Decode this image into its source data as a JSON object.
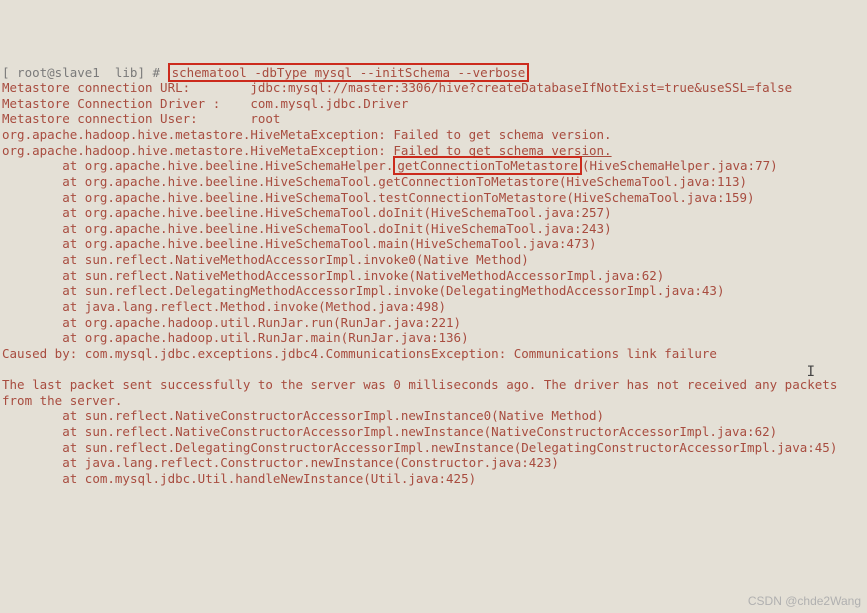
{
  "prompt": "[ root@slave1  lib] # ",
  "cmd": "schematool -dbType mysql --initSchema --verbose",
  "l1": "Metastore connection URL:\t jdbc:mysql://master:3306/hive?createDatabaseIfNotExist=true&useSSL=false",
  "l2": "Metastore Connection Driver :\t com.mysql.jdbc.Driver",
  "l3": "Metastore connection User:\t root",
  "l4": "org.apache.hadoop.hive.metastore.HiveMetaException: Failed to get schema version.",
  "l5": "org.apache.hadoop.hive.metastore.HiveMetaException: ",
  "l5u": "Failed to get schema version.",
  "l6a": "        at org.apache.hive.beeline.HiveSchemaHelper.",
  "l6h": "getConnectionToMetastore",
  "l6b": "(HiveSchemaHelper.java:77)",
  "l7": "        at org.apache.hive.beeline.HiveSchemaTool.getConnectionToMetastore(HiveSchemaTool.java:113)",
  "l8": "        at org.apache.hive.beeline.HiveSchemaTool.testConnectionToMetastore(HiveSchemaTool.java:159)",
  "l9": "        at org.apache.hive.beeline.HiveSchemaTool.doInit(HiveSchemaTool.java:257)",
  "l10": "        at org.apache.hive.beeline.HiveSchemaTool.doInit(HiveSchemaTool.java:243)",
  "l11": "        at org.apache.hive.beeline.HiveSchemaTool.main(HiveSchemaTool.java:473)",
  "l12": "        at sun.reflect.NativeMethodAccessorImpl.invoke0(Native Method)",
  "l13": "        at sun.reflect.NativeMethodAccessorImpl.invoke(NativeMethodAccessorImpl.java:62)",
  "l14": "        at sun.reflect.DelegatingMethodAccessorImpl.invoke(DelegatingMethodAccessorImpl.java:43)",
  "l15": "        at java.lang.reflect.Method.invoke(Method.java:498)",
  "l16": "        at org.apache.hadoop.util.RunJar.run(RunJar.java:221)",
  "l17": "        at org.apache.hadoop.util.RunJar.main(RunJar.java:136)",
  "l18": "Caused by: com.mysql.jdbc.exceptions.jdbc4.CommunicationsException: Communications link failure",
  "blank": "",
  "l19": "The last packet sent successfully to the server was 0 milliseconds ago. The driver has not received any packets from the server.",
  "l20": "        at sun.reflect.NativeConstructorAccessorImpl.newInstance0(Native Method)",
  "l21": "        at sun.reflect.NativeConstructorAccessorImpl.newInstance(NativeConstructorAccessorImpl.java:62)",
  "l22": "        at sun.reflect.DelegatingConstructorAccessorImpl.newInstance(DelegatingConstructorAccessorImpl.java:45)",
  "l23": "        at java.lang.reflect.Constructor.newInstance(Constructor.java:423)",
  "l24": "        at com.mysql.jdbc.Util.handleNewInstance(Util.java:425)",
  "watermark": "CSDN @chde2Wang"
}
